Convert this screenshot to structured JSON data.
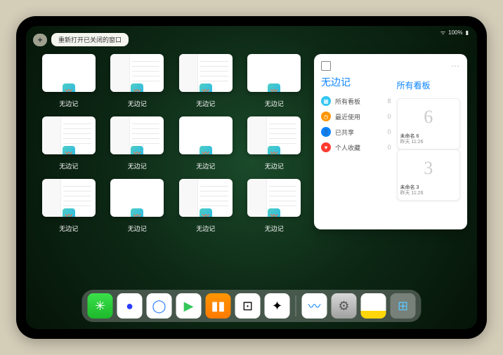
{
  "status": {
    "wifi": "ᐢ",
    "battery_pct": "100%"
  },
  "topbar": {
    "plus_label": "+",
    "reopen_label": "重新打开已关闭的窗口"
  },
  "grid_items": [
    {
      "label": "无边记",
      "type": "blank"
    },
    {
      "label": "无边记",
      "type": "split"
    },
    {
      "label": "无边记",
      "type": "split"
    },
    {
      "label": "无边记",
      "type": "blank"
    },
    {
      "label": "无边记",
      "type": "split"
    },
    {
      "label": "无边记",
      "type": "split"
    },
    {
      "label": "无边记",
      "type": "blank"
    },
    {
      "label": "无边记",
      "type": "split"
    },
    {
      "label": "无边记",
      "type": "split"
    },
    {
      "label": "无边记",
      "type": "blank"
    },
    {
      "label": "无边记",
      "type": "split"
    },
    {
      "label": "无边记",
      "type": "split"
    }
  ],
  "panel": {
    "title": "无边记",
    "right_title": "所有看板",
    "categories": [
      {
        "icon": "grid",
        "color": "#32c6f2",
        "label": "所有看板",
        "count": "8"
      },
      {
        "icon": "clock",
        "color": "#ff9500",
        "label": "最近使用",
        "count": "0"
      },
      {
        "icon": "person",
        "color": "#0a84ff",
        "label": "已共享",
        "count": "0"
      },
      {
        "icon": "heart",
        "color": "#ff3b30",
        "label": "个人收藏",
        "count": "0"
      }
    ],
    "boards": [
      {
        "sketch": "6",
        "name": "未命名 6",
        "date": "昨天 11:26"
      },
      {
        "sketch": "3",
        "name": "未命名 3",
        "date": "昨天 11:26"
      }
    ]
  },
  "dock_apps": [
    {
      "name": "wechat",
      "bg": "linear-gradient(#3ae04a,#1db92b)",
      "glyph": "✳",
      "glyph_color": "#fff"
    },
    {
      "name": "browser1",
      "bg": "#fff",
      "glyph": "●",
      "glyph_color": "#2a3cff"
    },
    {
      "name": "browser2",
      "bg": "#fff",
      "glyph": "◯",
      "glyph_color": "#2a7cff"
    },
    {
      "name": "play",
      "bg": "#fff",
      "glyph": "▶",
      "glyph_color": "#34c759"
    },
    {
      "name": "books",
      "bg": "linear-gradient(#ff9500,#ff7a00)",
      "glyph": "▮▮",
      "glyph_color": "#fff"
    },
    {
      "name": "dice",
      "bg": "#fff",
      "glyph": "⊡",
      "glyph_color": "#000"
    },
    {
      "name": "nodes",
      "bg": "#fff",
      "glyph": "✦",
      "glyph_color": "#000"
    }
  ],
  "dock_recent": [
    {
      "name": "freeform",
      "bg": "#fff",
      "glyph": "〰",
      "glyph_color": "#0a84ff"
    },
    {
      "name": "settings",
      "bg": "linear-gradient(#d8d8d8,#a0a0a0)",
      "glyph": "⚙",
      "glyph_color": "#555"
    },
    {
      "name": "notes",
      "bg": "linear-gradient(#fff 70%,#ffd60a 70%)",
      "glyph": "",
      "glyph_color": "#000"
    },
    {
      "name": "app-library",
      "bg": "rgba(200,200,200,.4)",
      "glyph": "⊞",
      "glyph_color": "#5ac8fa"
    }
  ]
}
